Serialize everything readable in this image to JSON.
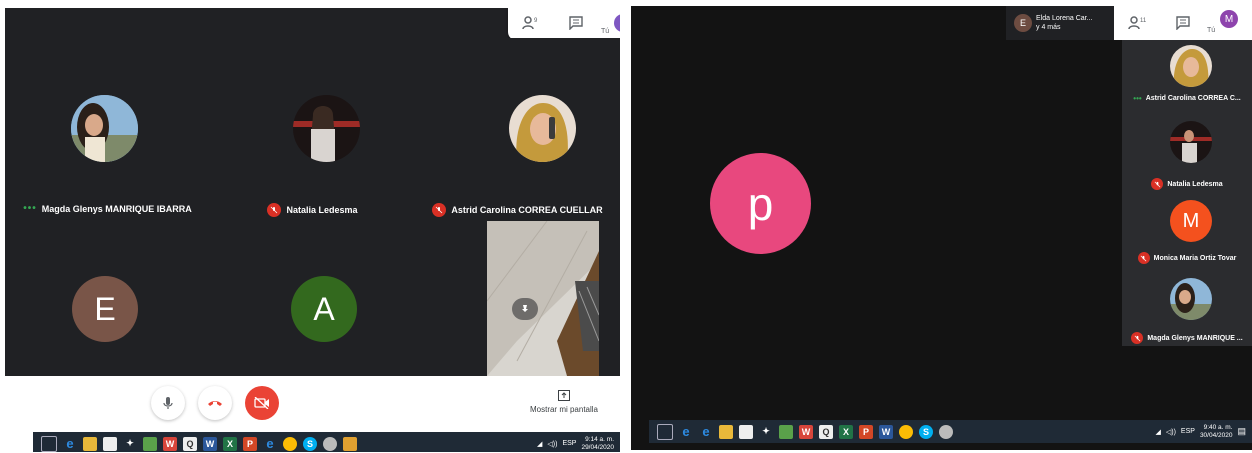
{
  "left": {
    "self_label": "Tú",
    "panel_icons": {
      "people": "people-icon",
      "chat": "chat-icon",
      "self_avatar_letter": ""
    },
    "participants": [
      {
        "name": "Magda Glenys MANRIQUE IBARRA",
        "type": "photo",
        "status": "speaking"
      },
      {
        "name": "Natalia Ledesma",
        "type": "photo",
        "status": "muted"
      },
      {
        "name": "Astrid Carolina CORREA CUELLAR",
        "type": "photo",
        "status": "muted"
      },
      {
        "name": "",
        "type": "letter",
        "letter": "E",
        "color": "#795548"
      },
      {
        "name": "",
        "type": "letter",
        "letter": "A",
        "color": "#33691e"
      }
    ],
    "controls": {
      "present_label": "Mostrar mi pantalla"
    },
    "taskbar": {
      "lang": "ESP",
      "time": "9:14 a. m.",
      "date": "29/04/2020"
    }
  },
  "right": {
    "speaker_label": "Elda Lorena Car...",
    "speaker_more": "y 4 más",
    "speaker_letter": "E",
    "self_label": "Tú",
    "self_avatar_letter": "M",
    "main_letter": "p",
    "main_color": "#e8487e",
    "sidebar": [
      {
        "name": "Astrid Carolina CORREA C...",
        "status": "speaking",
        "type": "photo"
      },
      {
        "name": "Natalia Ledesma",
        "status": "muted",
        "type": "photo"
      },
      {
        "name": "Monica Maria Ortiz Tovar",
        "status": "muted",
        "type": "letter",
        "letter": "M",
        "color": "#f4511e"
      },
      {
        "name": "Magda Glenys MANRIQUE ...",
        "status": "muted",
        "type": "photo"
      }
    ],
    "taskbar": {
      "lang": "ESP",
      "time": "9:40 a. m.",
      "date": "30/04/2020"
    }
  },
  "colors": {
    "meet_bg": "#202124",
    "end_call": "#ea4335",
    "mute": "#d93025"
  }
}
